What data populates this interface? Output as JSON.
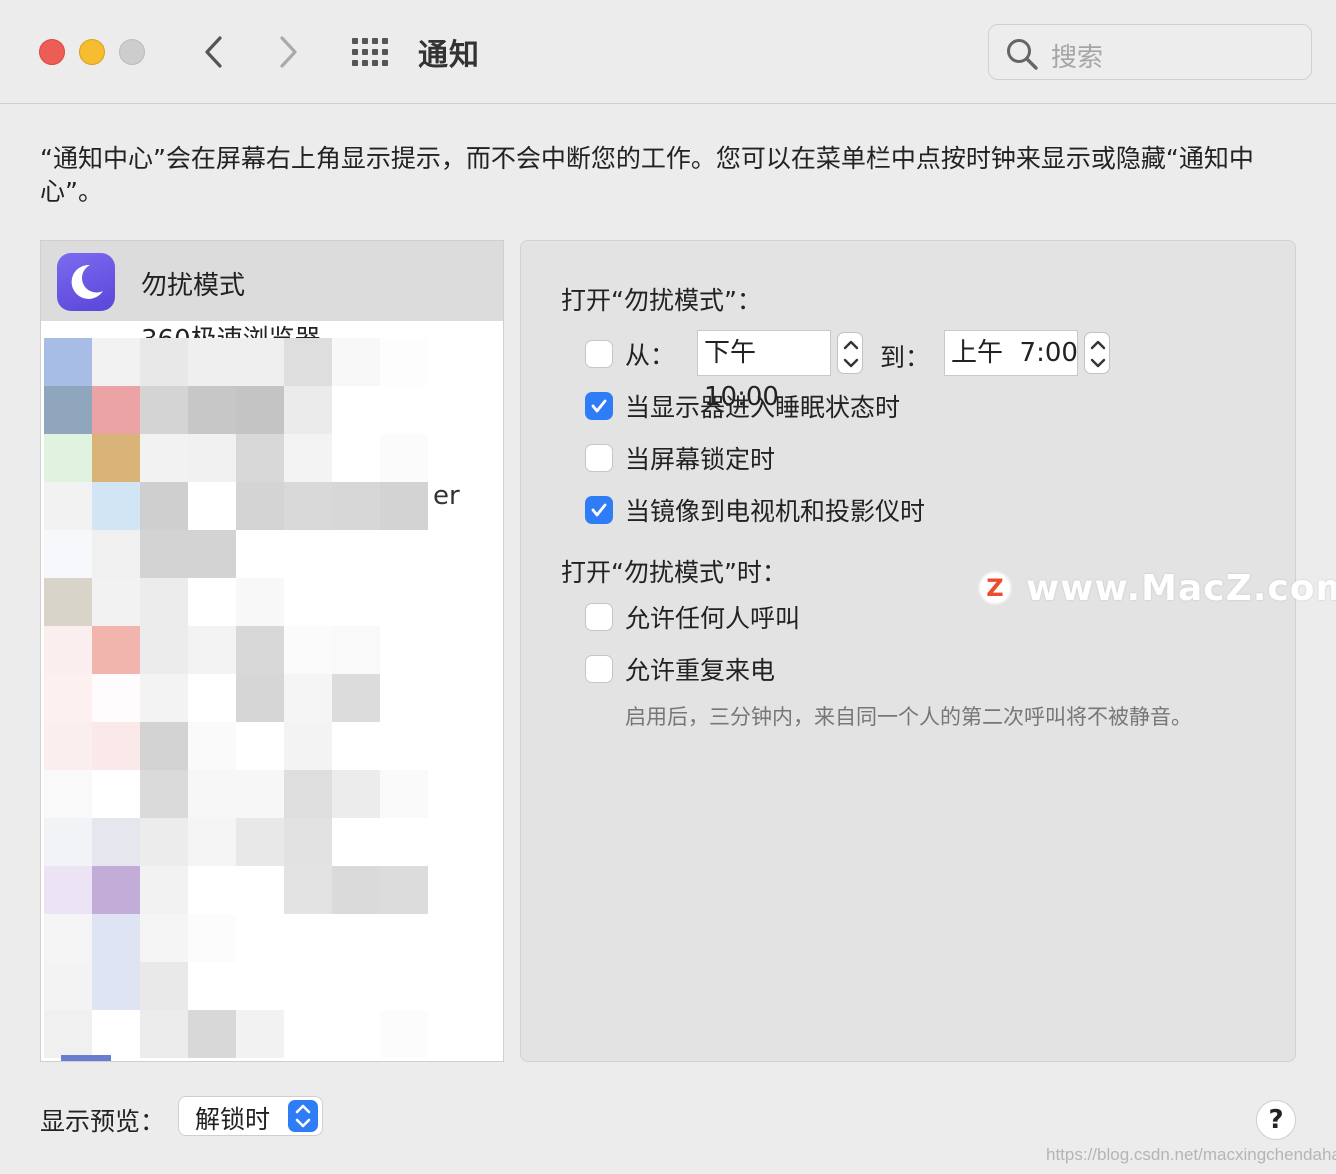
{
  "window": {
    "title": "通知"
  },
  "search": {
    "placeholder": "搜索"
  },
  "description": "“通知中心”会在屏幕右上角显示提示，而不会中断您的工作。您可以在菜单栏中点按时钟来显示或隐藏“通知中心”。",
  "sidebar": {
    "selected_item": {
      "label": "勿扰模式",
      "icon": "moon-icon"
    },
    "next_item_partial_label": "360极速浏览器",
    "partial_text": "er"
  },
  "dnd": {
    "section1_title": "打开“勿扰模式”：",
    "from_label": "从：",
    "from_time": "下午10:00",
    "to_label": "到：",
    "to_time": "上午  7:00",
    "from_checked": false,
    "options": [
      {
        "label": "当显示器进入睡眠状态时",
        "checked": true
      },
      {
        "label": "当屏幕锁定时",
        "checked": false
      },
      {
        "label": "当镜像到电视机和投影仪时",
        "checked": true
      }
    ],
    "section2_title": "打开“勿扰模式”时：",
    "options2": [
      {
        "label": "允许任何人呼叫",
        "checked": false
      },
      {
        "label": "允许重复来电",
        "checked": false
      }
    ],
    "note": "启用后，三分钟内，来自同一个人的第二次呼叫将不被静音。"
  },
  "footer": {
    "preview_label": "显示预览：",
    "preview_value": "解锁时",
    "help_label": "?"
  },
  "watermark": {
    "logo": "Z",
    "text": "www.MacZ.com"
  },
  "credit": "https://blog.csdn.net/macxingchendahai",
  "colors": {
    "accent": "#2e7cf6",
    "close": "#ee5d55",
    "minimize": "#f5bd2f"
  }
}
